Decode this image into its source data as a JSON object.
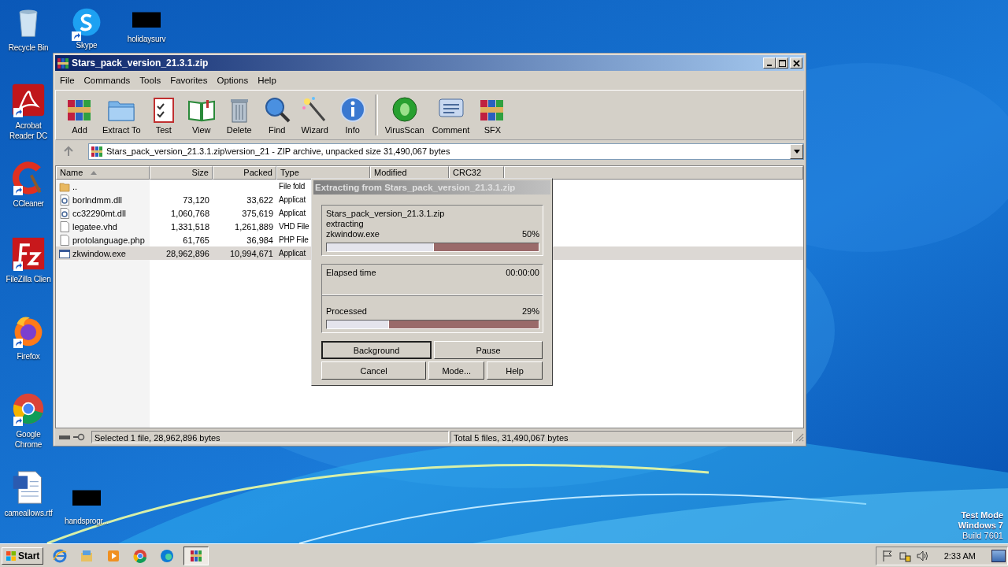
{
  "desktop_icons": [
    {
      "label": "Recycle Bin",
      "kind": "recycle",
      "shortcut": false
    },
    {
      "label": "Skype",
      "kind": "skype",
      "shortcut": true
    },
    {
      "label": "holidaysurv",
      "kind": "redacted",
      "shortcut": false
    },
    {
      "label": "Acrobat Reader DC",
      "kind": "acrobat",
      "shortcut": true
    },
    {
      "label": "CCleaner",
      "kind": "ccleaner",
      "shortcut": true
    },
    {
      "label": "FileZilla Clien",
      "kind": "filezilla",
      "shortcut": true
    },
    {
      "label": "Firefox",
      "kind": "firefox",
      "shortcut": true
    },
    {
      "label": "Google Chrome",
      "kind": "chrome",
      "shortcut": true
    },
    {
      "label": "cameallows.rtf",
      "kind": "word",
      "shortcut": false
    },
    {
      "label": "handsprogr...",
      "kind": "redacted",
      "shortcut": false
    }
  ],
  "window": {
    "title": "Stars_pack_version_21.3.1.zip",
    "menu": [
      "File",
      "Commands",
      "Tools",
      "Favorites",
      "Options",
      "Help"
    ],
    "toolbar": [
      {
        "label": "Add",
        "kind": "add"
      },
      {
        "label": "Extract To",
        "kind": "extract"
      },
      {
        "label": "Test",
        "kind": "test"
      },
      {
        "label": "View",
        "kind": "view"
      },
      {
        "label": "Delete",
        "kind": "delete"
      },
      {
        "label": "Find",
        "kind": "find"
      },
      {
        "label": "Wizard",
        "kind": "wizard"
      },
      {
        "label": "Info",
        "kind": "info"
      },
      {
        "label": "VirusScan",
        "kind": "virus"
      },
      {
        "label": "Comment",
        "kind": "comment"
      },
      {
        "label": "SFX",
        "kind": "sfx"
      }
    ],
    "address": "Stars_pack_version_21.3.1.zip\\version_21 - ZIP archive, unpacked size 31,490,067 bytes",
    "columns": [
      {
        "label": "Name",
        "sorted": true
      },
      {
        "label": "Size",
        "sorted": false
      },
      {
        "label": "Packed",
        "sorted": false
      },
      {
        "label": "Type",
        "sorted": false
      },
      {
        "label": "Modified",
        "sorted": false
      },
      {
        "label": "CRC32",
        "sorted": false
      }
    ],
    "rows": [
      {
        "name": "..",
        "size": "",
        "packed": "",
        "type": "File fold",
        "kind": "folder",
        "selected": false
      },
      {
        "name": "borlndmm.dll",
        "size": "73,120",
        "packed": "33,622",
        "type": "Applicat",
        "kind": "dll",
        "selected": false
      },
      {
        "name": "cc32290mt.dll",
        "size": "1,060,768",
        "packed": "375,619",
        "type": "Applicat",
        "kind": "dll",
        "selected": false
      },
      {
        "name": "legatee.vhd",
        "size": "1,331,518",
        "packed": "1,261,889",
        "type": "VHD File",
        "kind": "file",
        "selected": false
      },
      {
        "name": "protolanguage.php",
        "size": "61,765",
        "packed": "36,984",
        "type": "PHP File",
        "kind": "file",
        "selected": false
      },
      {
        "name": "zkwindow.exe",
        "size": "28,962,896",
        "packed": "10,994,671",
        "type": "Applicat",
        "kind": "exe",
        "selected": true
      }
    ],
    "status_left": "Selected 1 file, 28,962,896 bytes",
    "status_right": "Total 5 files, 31,490,067 bytes"
  },
  "dialog": {
    "title": "Extracting from Stars_pack_version_21.3.1.zip",
    "archive": "Stars_pack_version_21.3.1.zip",
    "action": "extracting",
    "file": "zkwindow.exe",
    "file_percent": "50%",
    "file_progress": {
      "level": 0.5
    },
    "elapsed_label": "Elapsed time",
    "elapsed": "00:00:00",
    "processed_label": "Processed",
    "processed_percent": "29%",
    "processed_progress": {
      "level": 0.29
    },
    "buttons": [
      {
        "label": "Background",
        "default": true
      },
      {
        "label": "Pause",
        "default": false
      },
      {
        "label": "Cancel",
        "default": false
      },
      {
        "label": "Mode...",
        "default": false
      },
      {
        "label": "Help",
        "default": false
      }
    ]
  },
  "test_mode": [
    "Test Mode",
    "Windows 7",
    "Build 7601"
  ],
  "taskbar": {
    "start": "Start",
    "apps": [
      {
        "kind": "ie",
        "active": false
      },
      {
        "kind": "explorer",
        "active": false
      },
      {
        "kind": "media",
        "active": false
      },
      {
        "kind": "chrome",
        "active": false
      },
      {
        "kind": "edge",
        "active": false
      },
      {
        "kind": "winrar",
        "active": true
      }
    ],
    "tray": [
      {
        "kind": "flag"
      },
      {
        "kind": "network"
      },
      {
        "kind": "speaker"
      }
    ],
    "clock": "2:33 AM"
  }
}
